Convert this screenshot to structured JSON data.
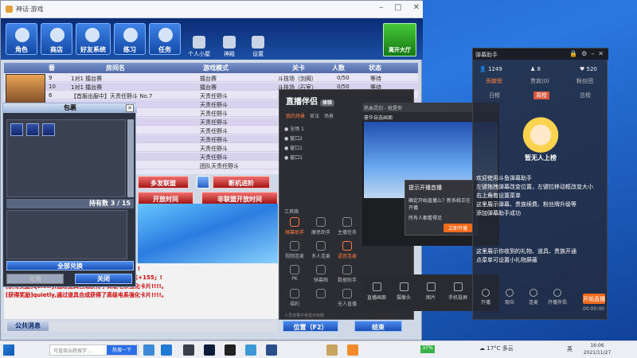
{
  "window": {
    "title": "神话·游戏"
  },
  "toolbar": {
    "buttons": [
      "角色",
      "商店",
      "好友系统",
      "练习",
      "任务"
    ],
    "small": [
      "个人小屋",
      "神殿",
      "设置"
    ],
    "exit": "离开大厅"
  },
  "rooms": {
    "headers": [
      "番",
      "房间名",
      "游戏模式",
      "关卡",
      "人数",
      "状态"
    ],
    "rows": [
      {
        "no": "9",
        "name": "1对1 擂台赛",
        "mode": "擂台赛",
        "stage": "斗技场（剑阁）",
        "count": "0/50",
        "status": "等待"
      },
      {
        "no": "10",
        "name": "1对1 擂台赛",
        "mode": "擂台赛",
        "stage": "斗技场（石室）",
        "count": "0/50",
        "status": "等待"
      },
      {
        "no": "6",
        "name": "【首服出服中】天责任野斗 No.7",
        "mode": "天责任野斗",
        "stage": "斗技场（墓场）",
        "count": "0/50",
        "status": "等待"
      },
      {
        "no": "",
        "name": "",
        "mode": "天责任野斗",
        "stage": "",
        "count": "",
        "status": ""
      },
      {
        "no": "",
        "name": "",
        "mode": "天责任野斗",
        "stage": "",
        "count": "",
        "status": ""
      },
      {
        "no": "",
        "name": "",
        "mode": "天责任野斗",
        "stage": "",
        "count": "",
        "status": ""
      },
      {
        "no": "",
        "name": "",
        "mode": "天责任野斗",
        "stage": "",
        "count": "",
        "status": ""
      },
      {
        "no": "",
        "name": "",
        "mode": "天责任野斗",
        "stage": "",
        "count": "",
        "status": ""
      },
      {
        "no": "",
        "name": "",
        "mode": "天责任野斗",
        "stage": "",
        "count": "",
        "status": ""
      },
      {
        "no": "",
        "name": "",
        "mode": "天责任野斗",
        "stage": "",
        "count": "",
        "status": ""
      },
      {
        "no": "",
        "name": "",
        "mode": "团队天责任野斗",
        "stage": "",
        "count": "",
        "status": ""
      }
    ]
  },
  "bag": {
    "title": "包裹",
    "count_label": "持有数 3 / 15",
    "exchange_all": "全部兑换",
    "confirm": "兑换",
    "close": "关闭"
  },
  "lobby": {
    "red1": "多发联盟",
    "red2": "断机进阶",
    "red3": "开放时间",
    "red4": "非联盟开放时间",
    "bottom1": "位置（F2）",
    "bottom2": "结束"
  },
  "chat": {
    "lines": [
      "[获得奖励]quietly,通过道具合成强化了「力量+1」!",
      "[获得奖励]附大的图腾着是到束手--道强化了「冰属性+155」!",
      "[获得奖励]quietly,通过道具合成获得了高级电系强化卡片!!!!。",
      "[获得奖励]quietly,通过道具合成获得了高级电系强化卡片!!!!。"
    ],
    "public": "公共消息"
  },
  "stream": {
    "logo": "直播伴侣",
    "badge": "体验",
    "tabs": [
      "我的场景",
      "官法",
      "场景"
    ],
    "scenes": [
      "全场 1",
      "窗口2",
      "窗口1",
      "窗口1"
    ],
    "preview_tab": "热血灵剑 - 就是你",
    "preview_title": "豪华自选画面",
    "tools_label": "工具箱",
    "tools": [
      "弹幕助手",
      "康思助手",
      "主播任务",
      "视频连麦",
      "多人连麦",
      "语音连麦",
      "PK",
      "弹幕图",
      "数据助手",
      "福利",
      "",
      "无人直播"
    ],
    "sources": [
      "直播画面",
      "摄像头",
      "图片",
      "手机投屏"
    ],
    "footer": "人员流量中待显示标题"
  },
  "popup": {
    "title": "提示开播首播",
    "body": "确定开始直播么？新系统正在开播",
    "sub": "所有人都看得见",
    "ok": "立即开播"
  },
  "danmu": {
    "title": "弹幕助手",
    "stats": [
      "1249",
      "8",
      "520"
    ],
    "tabs": [
      "贡献榜",
      "贵宾(0)",
      "粉丝团"
    ],
    "tabs2": [
      "日榜",
      "周榜",
      "总榜"
    ],
    "caption": "暂无人上榜",
    "welcome": [
      "欢迎使用斗鱼弹幕助手",
      "左键拖拽弹幕改变位置，左键拉移动框改变大小",
      "右上角有设置菜单",
      "这里展示弹幕、贵族续费、粉丝牌升级等",
      "添加弹幕助手成功"
    ],
    "info": [
      "这里展示你收到的礼物、道具、贵族开通",
      "点菜单可设置小礼物屏蔽"
    ],
    "bar": [
      "开播",
      "观众",
      "连麦",
      "开播伴侣"
    ],
    "golive": "开始直播",
    "time": "00:00:00"
  },
  "taskbar": {
    "search_placeholder": "可直接出题搜学 …",
    "search_btn": "热搜一下",
    "cpu": "37%",
    "weather": "17°C 多云",
    "lang": "英",
    "time": "16:06",
    "date": "2021/11/27"
  }
}
